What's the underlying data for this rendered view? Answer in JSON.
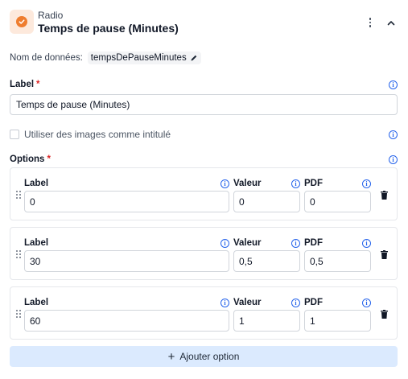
{
  "header": {
    "type_label": "Radio",
    "title": "Temps de pause (Minutes)",
    "icons": {
      "type": "check-circle-icon",
      "menu": "more-vertical-icon",
      "collapse": "chevron-up-icon"
    }
  },
  "data_name": {
    "label": "Nom de données:",
    "value": "tempsDePauseMinutes",
    "edit_icon": "pencil-icon"
  },
  "label_field": {
    "label": "Label",
    "required_mark": "*",
    "value": "Temps de pause (Minutes)"
  },
  "use_images": {
    "label": "Utiliser des images comme intitulé",
    "checked": false
  },
  "options": {
    "label": "Options",
    "required_mark": "*",
    "col_label": "Label",
    "col_value": "Valeur",
    "col_pdf": "PDF",
    "items": [
      {
        "label": "0",
        "value": "0",
        "pdf": "0"
      },
      {
        "label": "30",
        "value": "0,5",
        "pdf": "0,5"
      },
      {
        "label": "60",
        "value": "1",
        "pdf": "1"
      }
    ]
  },
  "add_option": {
    "icon": "+",
    "label": "Ajouter option"
  },
  "colors": {
    "accent": "#ef7d2f",
    "info": "#2563eb",
    "required": "#dc2626",
    "add_bg": "#dbeafe"
  }
}
